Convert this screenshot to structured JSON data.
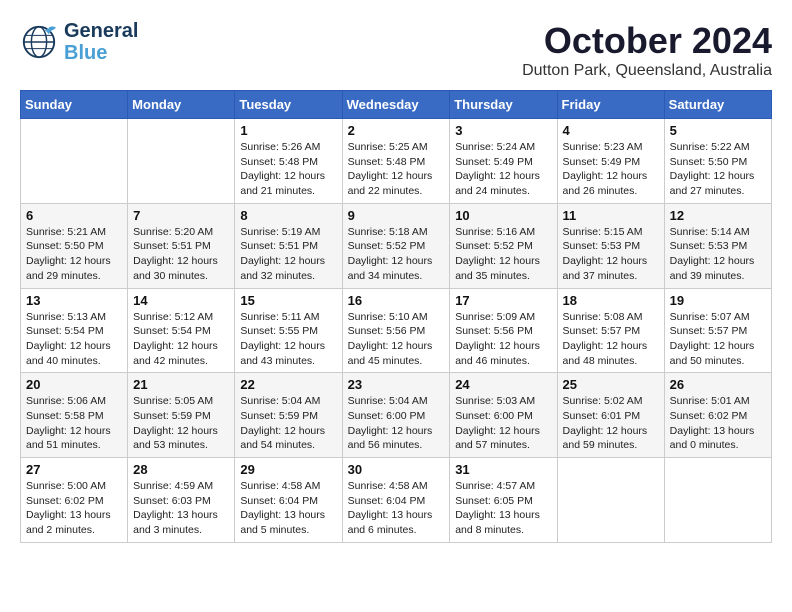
{
  "header": {
    "logo_line1": "General",
    "logo_line2": "Blue",
    "month_title": "October 2024",
    "location": "Dutton Park, Queensland, Australia"
  },
  "days_of_week": [
    "Sunday",
    "Monday",
    "Tuesday",
    "Wednesday",
    "Thursday",
    "Friday",
    "Saturday"
  ],
  "weeks": [
    [
      {
        "day": "",
        "info": ""
      },
      {
        "day": "",
        "info": ""
      },
      {
        "day": "1",
        "info": "Sunrise: 5:26 AM\nSunset: 5:48 PM\nDaylight: 12 hours\nand 21 minutes."
      },
      {
        "day": "2",
        "info": "Sunrise: 5:25 AM\nSunset: 5:48 PM\nDaylight: 12 hours\nand 22 minutes."
      },
      {
        "day": "3",
        "info": "Sunrise: 5:24 AM\nSunset: 5:49 PM\nDaylight: 12 hours\nand 24 minutes."
      },
      {
        "day": "4",
        "info": "Sunrise: 5:23 AM\nSunset: 5:49 PM\nDaylight: 12 hours\nand 26 minutes."
      },
      {
        "day": "5",
        "info": "Sunrise: 5:22 AM\nSunset: 5:50 PM\nDaylight: 12 hours\nand 27 minutes."
      }
    ],
    [
      {
        "day": "6",
        "info": "Sunrise: 5:21 AM\nSunset: 5:50 PM\nDaylight: 12 hours\nand 29 minutes."
      },
      {
        "day": "7",
        "info": "Sunrise: 5:20 AM\nSunset: 5:51 PM\nDaylight: 12 hours\nand 30 minutes."
      },
      {
        "day": "8",
        "info": "Sunrise: 5:19 AM\nSunset: 5:51 PM\nDaylight: 12 hours\nand 32 minutes."
      },
      {
        "day": "9",
        "info": "Sunrise: 5:18 AM\nSunset: 5:52 PM\nDaylight: 12 hours\nand 34 minutes."
      },
      {
        "day": "10",
        "info": "Sunrise: 5:16 AM\nSunset: 5:52 PM\nDaylight: 12 hours\nand 35 minutes."
      },
      {
        "day": "11",
        "info": "Sunrise: 5:15 AM\nSunset: 5:53 PM\nDaylight: 12 hours\nand 37 minutes."
      },
      {
        "day": "12",
        "info": "Sunrise: 5:14 AM\nSunset: 5:53 PM\nDaylight: 12 hours\nand 39 minutes."
      }
    ],
    [
      {
        "day": "13",
        "info": "Sunrise: 5:13 AM\nSunset: 5:54 PM\nDaylight: 12 hours\nand 40 minutes."
      },
      {
        "day": "14",
        "info": "Sunrise: 5:12 AM\nSunset: 5:54 PM\nDaylight: 12 hours\nand 42 minutes."
      },
      {
        "day": "15",
        "info": "Sunrise: 5:11 AM\nSunset: 5:55 PM\nDaylight: 12 hours\nand 43 minutes."
      },
      {
        "day": "16",
        "info": "Sunrise: 5:10 AM\nSunset: 5:56 PM\nDaylight: 12 hours\nand 45 minutes."
      },
      {
        "day": "17",
        "info": "Sunrise: 5:09 AM\nSunset: 5:56 PM\nDaylight: 12 hours\nand 46 minutes."
      },
      {
        "day": "18",
        "info": "Sunrise: 5:08 AM\nSunset: 5:57 PM\nDaylight: 12 hours\nand 48 minutes."
      },
      {
        "day": "19",
        "info": "Sunrise: 5:07 AM\nSunset: 5:57 PM\nDaylight: 12 hours\nand 50 minutes."
      }
    ],
    [
      {
        "day": "20",
        "info": "Sunrise: 5:06 AM\nSunset: 5:58 PM\nDaylight: 12 hours\nand 51 minutes."
      },
      {
        "day": "21",
        "info": "Sunrise: 5:05 AM\nSunset: 5:59 PM\nDaylight: 12 hours\nand 53 minutes."
      },
      {
        "day": "22",
        "info": "Sunrise: 5:04 AM\nSunset: 5:59 PM\nDaylight: 12 hours\nand 54 minutes."
      },
      {
        "day": "23",
        "info": "Sunrise: 5:04 AM\nSunset: 6:00 PM\nDaylight: 12 hours\nand 56 minutes."
      },
      {
        "day": "24",
        "info": "Sunrise: 5:03 AM\nSunset: 6:00 PM\nDaylight: 12 hours\nand 57 minutes."
      },
      {
        "day": "25",
        "info": "Sunrise: 5:02 AM\nSunset: 6:01 PM\nDaylight: 12 hours\nand 59 minutes."
      },
      {
        "day": "26",
        "info": "Sunrise: 5:01 AM\nSunset: 6:02 PM\nDaylight: 13 hours\nand 0 minutes."
      }
    ],
    [
      {
        "day": "27",
        "info": "Sunrise: 5:00 AM\nSunset: 6:02 PM\nDaylight: 13 hours\nand 2 minutes."
      },
      {
        "day": "28",
        "info": "Sunrise: 4:59 AM\nSunset: 6:03 PM\nDaylight: 13 hours\nand 3 minutes."
      },
      {
        "day": "29",
        "info": "Sunrise: 4:58 AM\nSunset: 6:04 PM\nDaylight: 13 hours\nand 5 minutes."
      },
      {
        "day": "30",
        "info": "Sunrise: 4:58 AM\nSunset: 6:04 PM\nDaylight: 13 hours\nand 6 minutes."
      },
      {
        "day": "31",
        "info": "Sunrise: 4:57 AM\nSunset: 6:05 PM\nDaylight: 13 hours\nand 8 minutes."
      },
      {
        "day": "",
        "info": ""
      },
      {
        "day": "",
        "info": ""
      }
    ]
  ]
}
